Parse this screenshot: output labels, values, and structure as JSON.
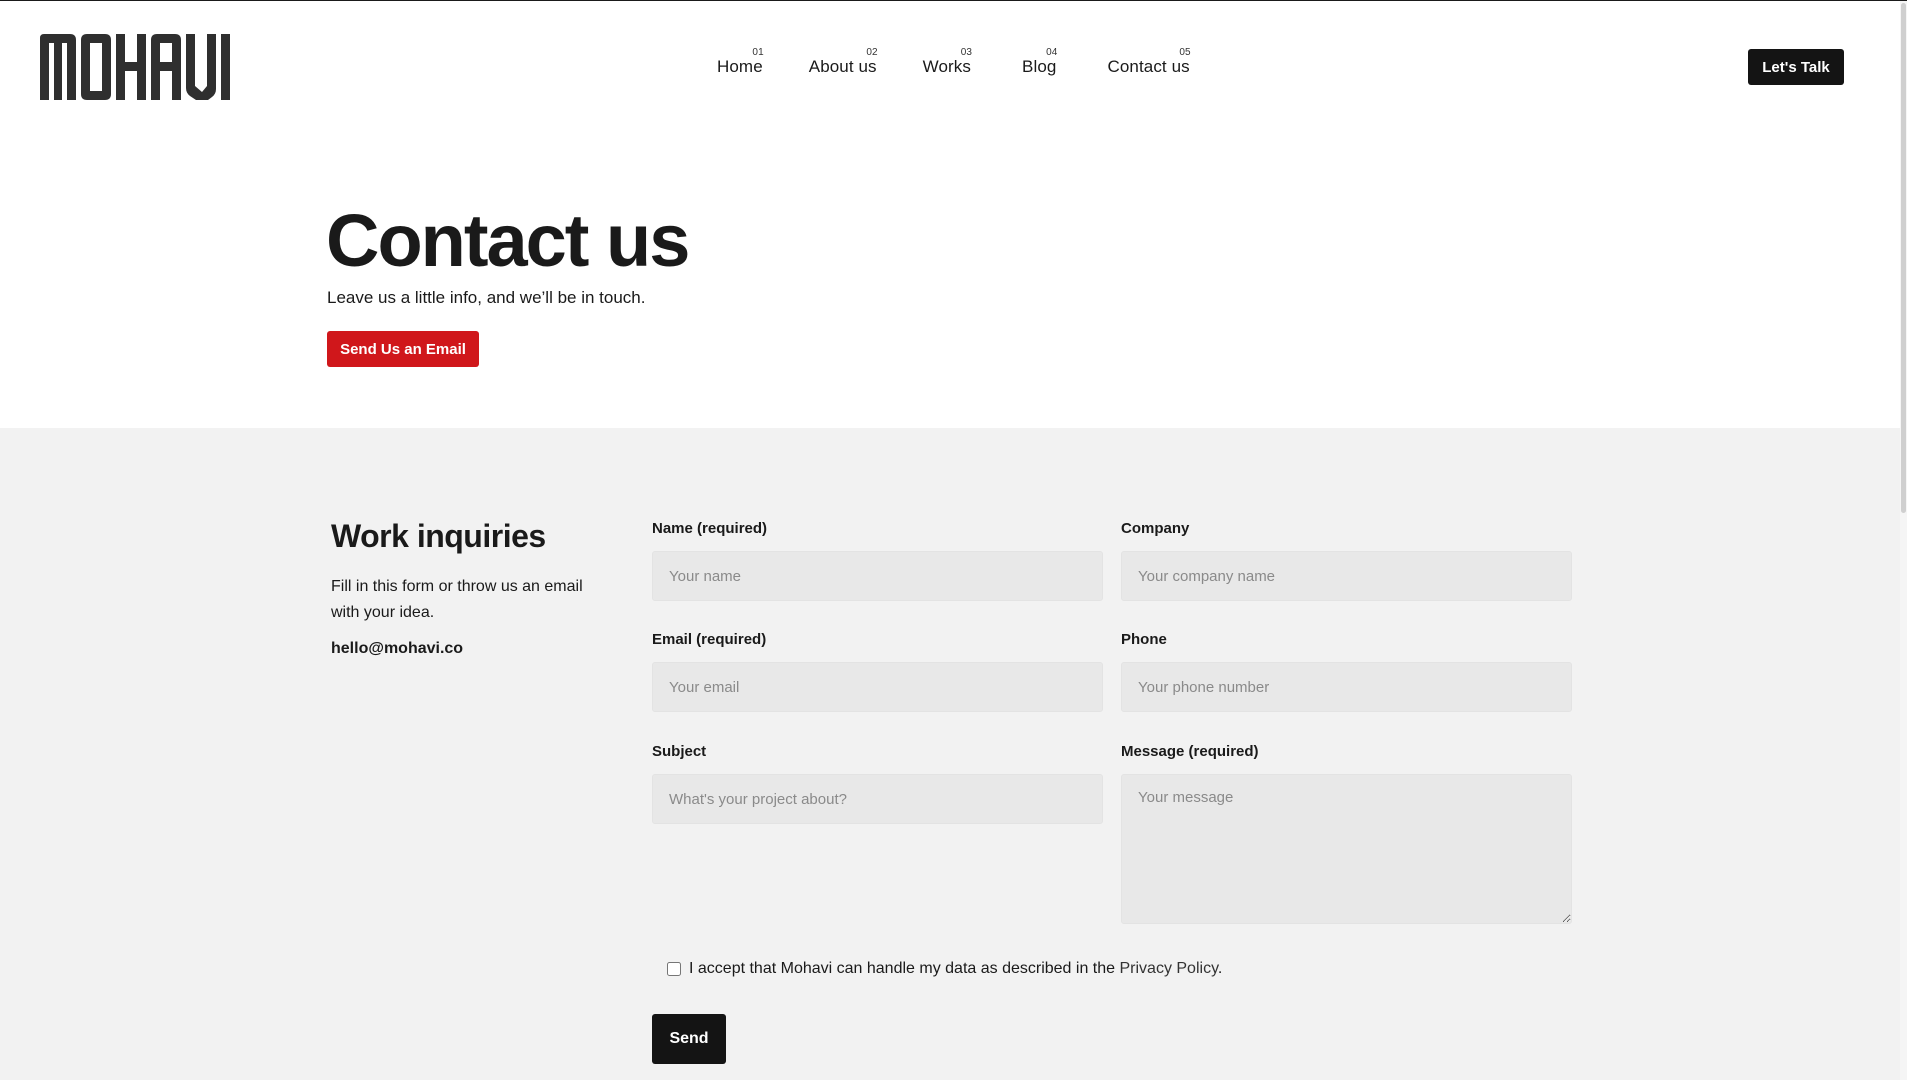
{
  "brand": {
    "logo_text": "MOHAVI"
  },
  "nav": {
    "items": [
      {
        "num": "01",
        "label": "Home"
      },
      {
        "num": "02",
        "label": "About us"
      },
      {
        "num": "03",
        "label": "Works"
      },
      {
        "num": "04",
        "label": "Blog"
      },
      {
        "num": "05",
        "label": "Contact us"
      }
    ],
    "cta_label": "Let's Talk"
  },
  "hero": {
    "title": "Contact us",
    "subtitle": "Leave us a little info, and we’ll be in touch.",
    "email_button_label": "Send Us an Email"
  },
  "inquiry": {
    "title": "Work inquiries",
    "description": "Fill in this form or throw us an email with your idea.",
    "email": "hello@mohavi.co"
  },
  "form": {
    "name": {
      "label": "Name (required)",
      "placeholder": "Your name",
      "value": ""
    },
    "company": {
      "label": "Company",
      "placeholder": "Your company name",
      "value": ""
    },
    "email": {
      "label": "Email (required)",
      "placeholder": "Your email",
      "value": ""
    },
    "phone": {
      "label": "Phone",
      "placeholder": "Your phone number",
      "value": ""
    },
    "subject": {
      "label": "Subject",
      "placeholder": "What's your project about?",
      "value": ""
    },
    "message": {
      "label": "Message (required)",
      "placeholder": "Your message",
      "value": ""
    },
    "consent_text": "I accept that Mohavi can handle my data as described in the",
    "consent_link": "Privacy Policy",
    "consent_end": ".",
    "consent_checked": false,
    "submit_label": "Send"
  },
  "colors": {
    "accent_red": "#d0171b",
    "dark": "#141414",
    "section_bg": "#f2f2f2"
  }
}
